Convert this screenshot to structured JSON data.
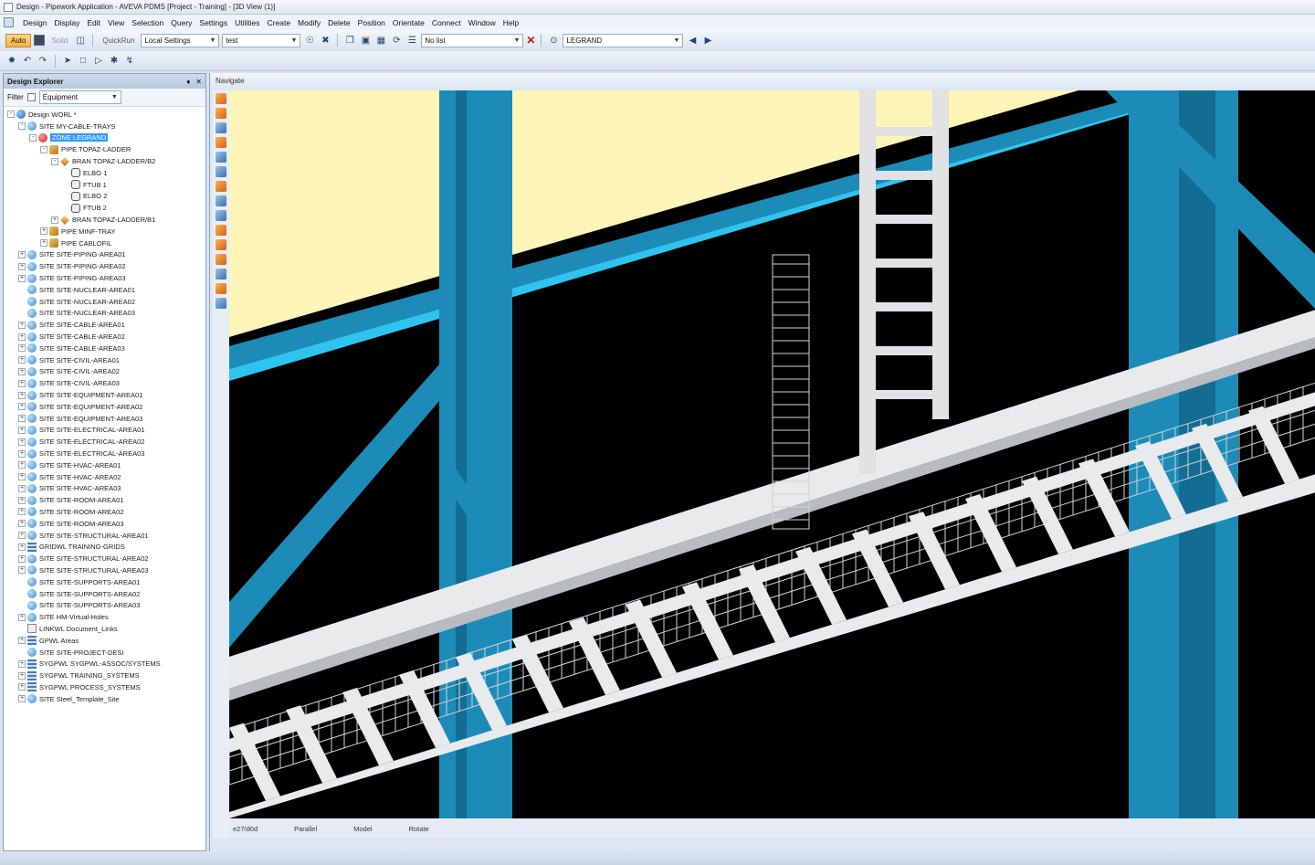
{
  "window": {
    "title": "Design - Pipework Application - AVEVA PDMS [Project - Training] - [3D View (1)]"
  },
  "menu": [
    "Design",
    "Display",
    "Edit",
    "View",
    "Selection",
    "Query",
    "Settings",
    "Utilities",
    "Create",
    "Modify",
    "Delete",
    "Position",
    "Orientate",
    "Connect",
    "Window",
    "Help"
  ],
  "toolbar": {
    "auto_label": "Auto",
    "solid_label": "Solid",
    "quickrun_label": "QuickRun",
    "settings_combo": "Local Settings",
    "test_combo": "test",
    "list_combo": "No list",
    "legrand_combo": "LEGRAND"
  },
  "explorer": {
    "title": "Design Explorer",
    "filter_label": "Filter",
    "filter_value": "Equipment",
    "items": [
      {
        "label": "Design WORL *",
        "indent": 0,
        "icon": "world",
        "exp": "-"
      },
      {
        "label": "SITE MY-CABLE-TRAYS",
        "indent": 1,
        "icon": "site",
        "exp": "-"
      },
      {
        "label": "ZONE LEGRAND",
        "indent": 2,
        "icon": "zone",
        "exp": "-",
        "selected": true
      },
      {
        "label": "PIPE TOPAZ-LADDER",
        "indent": 3,
        "icon": "pipe",
        "exp": "-"
      },
      {
        "label": "BRAN TOPAZ-LADDER/B2",
        "indent": 4,
        "icon": "bran",
        "exp": "-"
      },
      {
        "label": "ELBO 1",
        "indent": 5,
        "icon": "comp",
        "exp": ""
      },
      {
        "label": "FTUB 1",
        "indent": 5,
        "icon": "comp",
        "exp": ""
      },
      {
        "label": "ELBO 2",
        "indent": 5,
        "icon": "comp",
        "exp": ""
      },
      {
        "label": "FTUB 2",
        "indent": 5,
        "icon": "comp",
        "exp": ""
      },
      {
        "label": "BRAN TOPAZ-LADDER/B1",
        "indent": 4,
        "icon": "bran",
        "exp": "+"
      },
      {
        "label": "PIPE MINF-TRAY",
        "indent": 3,
        "icon": "pipe",
        "exp": "+"
      },
      {
        "label": "PIPE CABLOFIL",
        "indent": 3,
        "icon": "pipe",
        "exp": "+"
      },
      {
        "label": "SITE SITE-PIPING-AREA01",
        "indent": 1,
        "icon": "site",
        "exp": "+"
      },
      {
        "label": "SITE SITE-PIPING-AREA02",
        "indent": 1,
        "icon": "site",
        "exp": "+"
      },
      {
        "label": "SITE SITE-PIPING-AREA03",
        "indent": 1,
        "icon": "site",
        "exp": "+"
      },
      {
        "label": "SITE SITE-NUCLEAR-AREA01",
        "indent": 1,
        "icon": "site",
        "exp": ""
      },
      {
        "label": "SITE SITE-NUCLEAR-AREA02",
        "indent": 1,
        "icon": "site",
        "exp": ""
      },
      {
        "label": "SITE SITE-NUCLEAR-AREA03",
        "indent": 1,
        "icon": "site",
        "exp": ""
      },
      {
        "label": "SITE SITE-CABLE-AREA01",
        "indent": 1,
        "icon": "site",
        "exp": "+"
      },
      {
        "label": "SITE SITE-CABLE-AREA02",
        "indent": 1,
        "icon": "site",
        "exp": "+"
      },
      {
        "label": "SITE SITE-CABLE-AREA03",
        "indent": 1,
        "icon": "site",
        "exp": "+"
      },
      {
        "label": "SITE SITE-CIVIL-AREA01",
        "indent": 1,
        "icon": "site",
        "exp": "+"
      },
      {
        "label": "SITE SITE-CIVIL-AREA02",
        "indent": 1,
        "icon": "site",
        "exp": "+"
      },
      {
        "label": "SITE SITE-CIVIL-AREA03",
        "indent": 1,
        "icon": "site",
        "exp": "+"
      },
      {
        "label": "SITE SITE-EQUIPMENT-AREA01",
        "indent": 1,
        "icon": "site",
        "exp": "+"
      },
      {
        "label": "SITE SITE-EQUIPMENT-AREA02",
        "indent": 1,
        "icon": "site",
        "exp": "+"
      },
      {
        "label": "SITE SITE-EQUIPMENT-AREA03",
        "indent": 1,
        "icon": "site",
        "exp": "+"
      },
      {
        "label": "SITE SITE-ELECTRICAL-AREA01",
        "indent": 1,
        "icon": "site",
        "exp": "+"
      },
      {
        "label": "SITE SITE-ELECTRICAL-AREA02",
        "indent": 1,
        "icon": "site",
        "exp": "+"
      },
      {
        "label": "SITE SITE-ELECTRICAL-AREA03",
        "indent": 1,
        "icon": "site",
        "exp": "+"
      },
      {
        "label": "SITE SITE-HVAC-AREA01",
        "indent": 1,
        "icon": "site",
        "exp": "+"
      },
      {
        "label": "SITE SITE-HVAC-AREA02",
        "indent": 1,
        "icon": "site",
        "exp": "+"
      },
      {
        "label": "SITE SITE-HVAC-AREA03",
        "indent": 1,
        "icon": "site",
        "exp": "+"
      },
      {
        "label": "SITE SITE-ROOM-AREA01",
        "indent": 1,
        "icon": "site",
        "exp": "+"
      },
      {
        "label": "SITE SITE-ROOM-AREA02",
        "indent": 1,
        "icon": "site",
        "exp": "+"
      },
      {
        "label": "SITE SITE-ROOM-AREA03",
        "indent": 1,
        "icon": "site",
        "exp": "+"
      },
      {
        "label": "SITE SITE-STRUCTURAL-AREA01",
        "indent": 1,
        "icon": "site",
        "exp": "+"
      },
      {
        "label": "GRIDWL TRAINING-GRIDS",
        "indent": 1,
        "icon": "grid",
        "exp": "+"
      },
      {
        "label": "SITE SITE-STRUCTURAL-AREA02",
        "indent": 1,
        "icon": "site",
        "exp": "+"
      },
      {
        "label": "SITE SITE-STRUCTURAL-AREA03",
        "indent": 1,
        "icon": "site",
        "exp": "+"
      },
      {
        "label": "SITE SITE-SUPPORTS-AREA01",
        "indent": 1,
        "icon": "site",
        "exp": ""
      },
      {
        "label": "SITE SITE-SUPPORTS-AREA02",
        "indent": 1,
        "icon": "site",
        "exp": ""
      },
      {
        "label": "SITE SITE-SUPPORTS-AREA03",
        "indent": 1,
        "icon": "site",
        "exp": ""
      },
      {
        "label": "SITE HM-Virtual-Holes",
        "indent": 1,
        "icon": "site",
        "exp": "+"
      },
      {
        "label": "LINKWL Document_Links",
        "indent": 1,
        "icon": "link",
        "exp": ""
      },
      {
        "label": "GPWL Areas",
        "indent": 1,
        "icon": "grid",
        "exp": "+"
      },
      {
        "label": "SITE SITE-PROJECT-DESI",
        "indent": 1,
        "icon": "site",
        "exp": ""
      },
      {
        "label": "SYGPWL SYGPWL-ASSOC/SYSTEMS",
        "indent": 1,
        "icon": "grid",
        "exp": "+"
      },
      {
        "label": "SYGPWL TRAINING_SYSTEMS",
        "indent": 1,
        "icon": "grid",
        "exp": "+"
      },
      {
        "label": "SYGPWL PROCESS_SYSTEMS",
        "indent": 1,
        "icon": "grid",
        "exp": "+"
      },
      {
        "label": "SITE Steel_Template_Site",
        "indent": 1,
        "icon": "site",
        "exp": "+"
      }
    ]
  },
  "viewport": {
    "nav_label": "Navigate",
    "status": [
      "e27/d0d",
      "Parallel",
      "Model",
      "Rotate"
    ]
  },
  "colors": {
    "steel": "#1d8bb8",
    "steel_light": "#2fc4f0",
    "floor": "#fdf5b8",
    "tray": "#e8eaec",
    "background": "#000000"
  }
}
